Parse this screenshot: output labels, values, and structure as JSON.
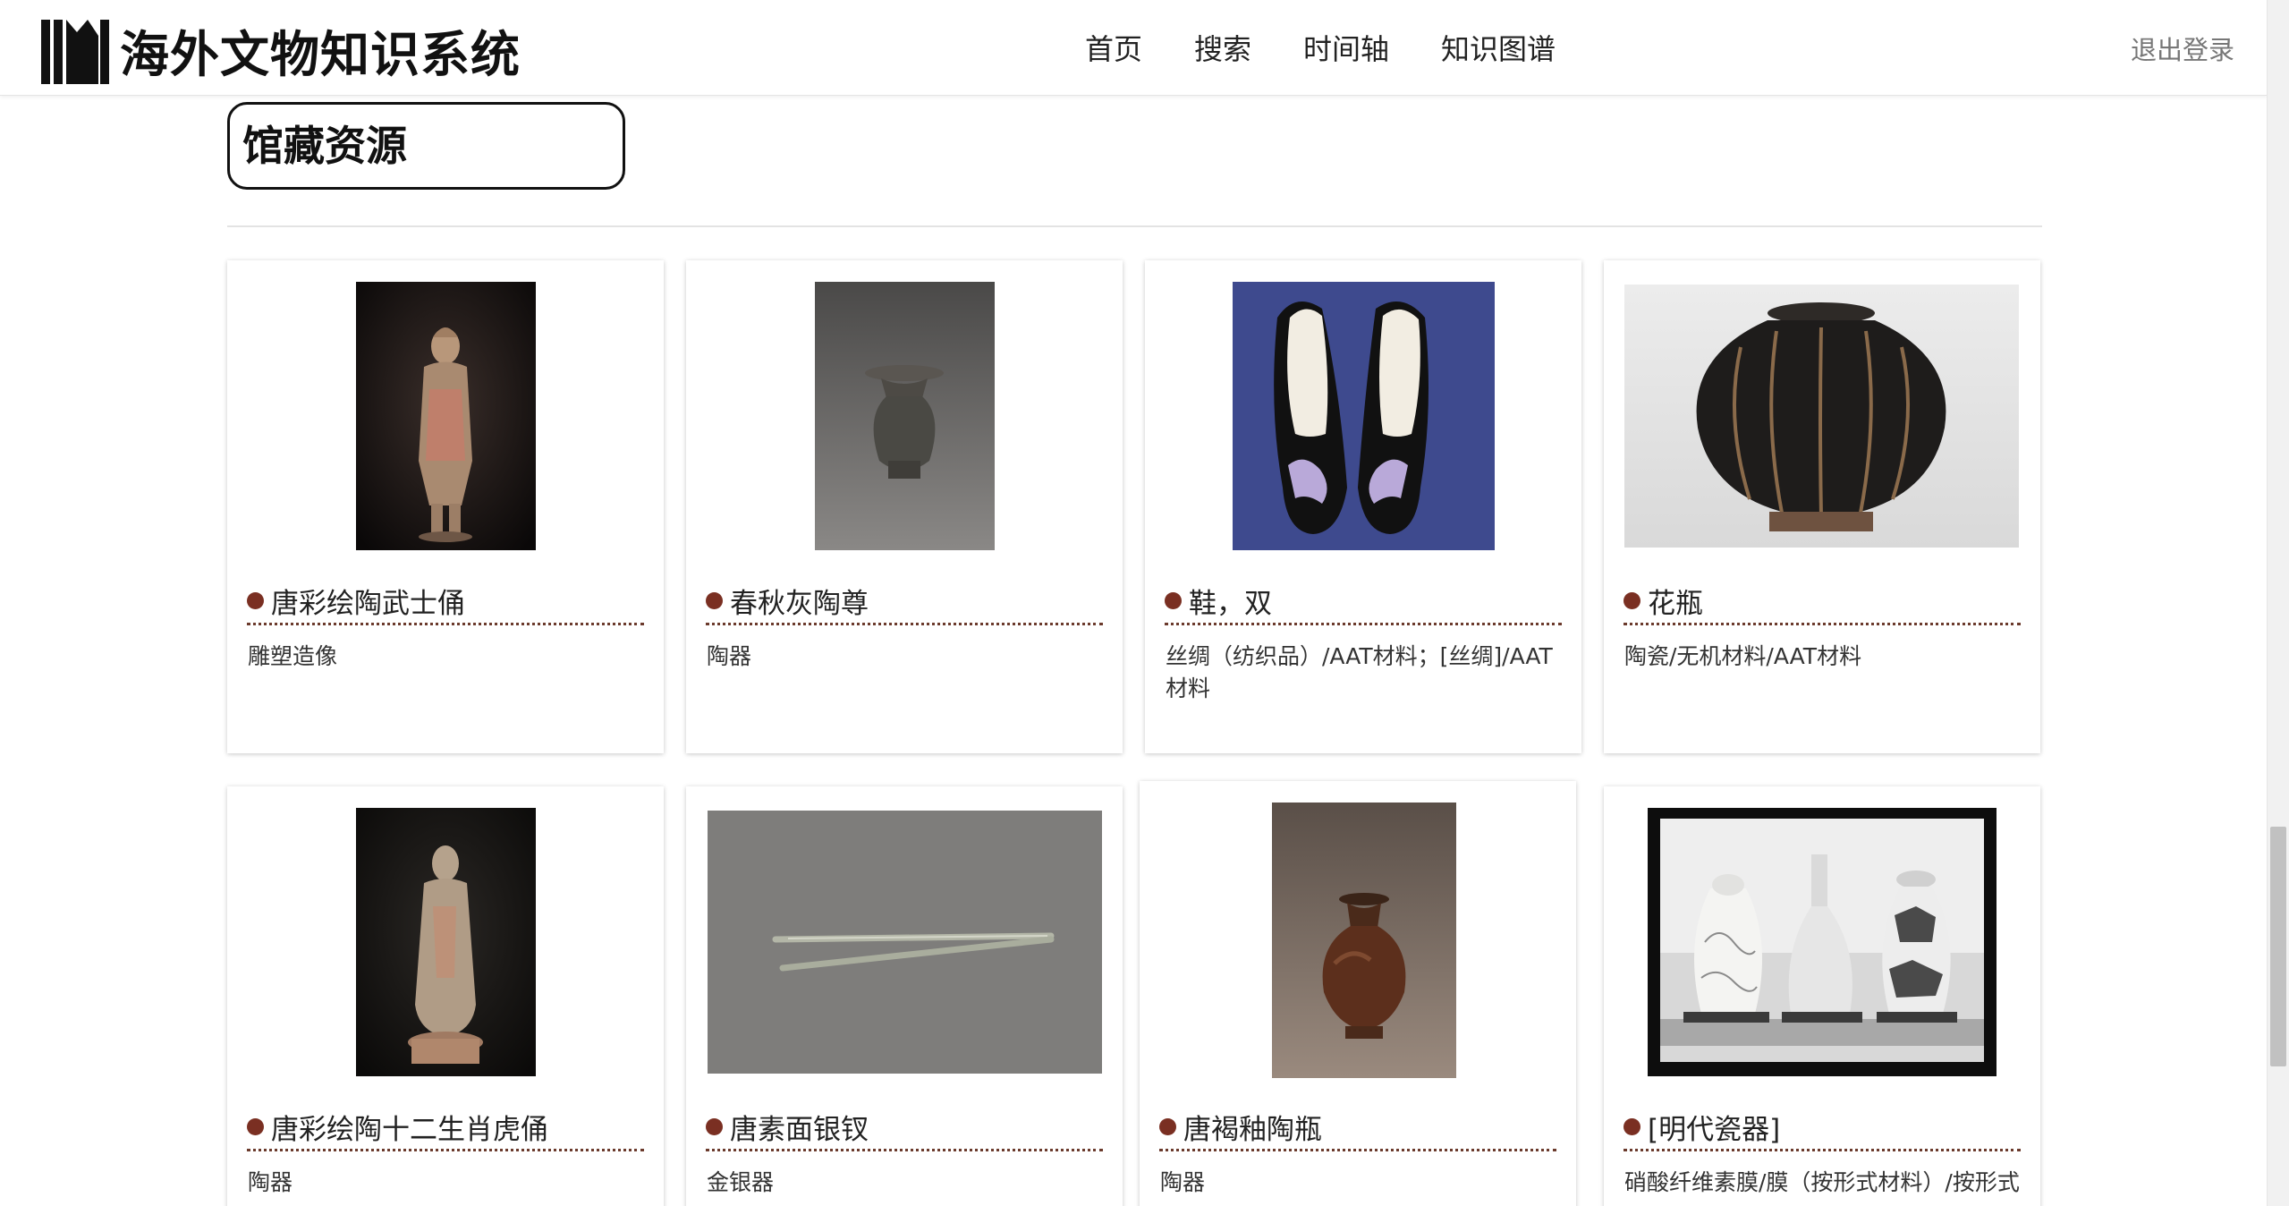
{
  "header": {
    "logo_text": "海外文物知识系统",
    "nav": [
      "首页",
      "搜索",
      "时间轴",
      "知识图谱"
    ],
    "logout": "退出登录"
  },
  "section": {
    "title": "馆藏资源"
  },
  "cards": [
    {
      "title": "唐彩绘陶武士俑",
      "category": "雕塑造像"
    },
    {
      "title": "春秋灰陶尊",
      "category": "陶器"
    },
    {
      "title": "鞋，双",
      "category": "丝绸（纺织品）/AAT材料；[丝绸]/AAT材料"
    },
    {
      "title": "花瓶",
      "category": "陶瓷/无机材料/AAT材料"
    },
    {
      "title": "唐彩绘陶十二生肖虎俑",
      "category": "陶器"
    },
    {
      "title": "唐素面银钗",
      "category": "金银器"
    },
    {
      "title": "唐褐釉陶瓶",
      "category": "陶器"
    },
    {
      "title": "[明代瓷器]",
      "category": "硝酸纤维素膜/膜（按形式材料）/按形式"
    }
  ],
  "colors": {
    "accent_dot": "#7a2f22",
    "dotted_rule": "#6b3a2c"
  }
}
